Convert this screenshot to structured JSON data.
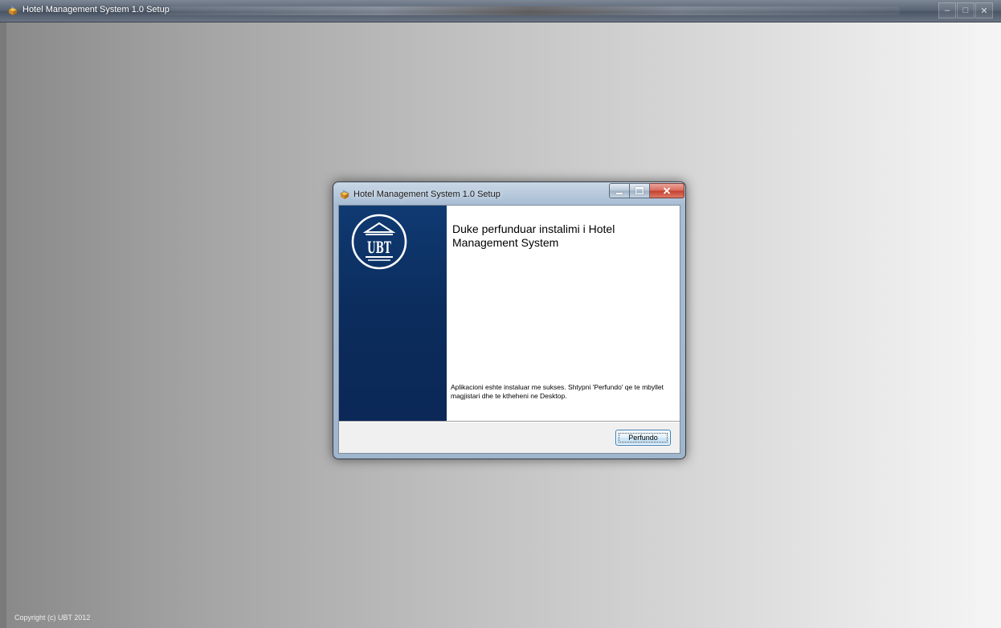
{
  "window": {
    "title": "Hotel Management System 1.0 Setup",
    "controls": [
      "minimize",
      "maximize",
      "close"
    ]
  },
  "footer": {
    "copyright": "Copyright (c) UBT 2012"
  },
  "dialog": {
    "title": "Hotel Management System 1.0 Setup",
    "logo_text": "UBT",
    "heading": "Duke perfunduar instalimi i Hotel Management System",
    "message": "Aplikacioni eshte instaluar me sukses. Shtypni 'Perfundo' qe te mbyllet magjistari dhe te ktheheni ne Desktop.",
    "finish_label": "Perfundo"
  },
  "colors": {
    "banner": "#0b2c5c",
    "accent_button": "#3c7fb1"
  }
}
